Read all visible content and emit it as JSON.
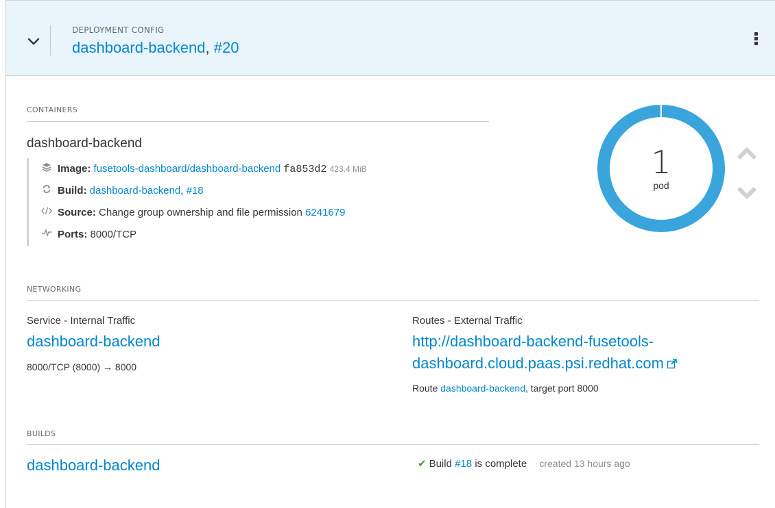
{
  "header": {
    "kind": "DEPLOYMENT CONFIG",
    "name": "dashboard-backend",
    "separator": ",",
    "revision": "#20"
  },
  "containers": {
    "section_label": "CONTAINERS",
    "container_name": "dashboard-backend",
    "image": {
      "label": "Image:",
      "link": "fusetools-dashboard/dashboard-backend",
      "id": "fa853d2",
      "size": "423.4 MiB"
    },
    "build": {
      "label": "Build:",
      "name": "dashboard-backend",
      "separator": ",",
      "number": "#18"
    },
    "source": {
      "label": "Source:",
      "message": "Change group ownership and file permission",
      "commit": "6241679"
    },
    "ports": {
      "label": "Ports:",
      "value": "8000/TCP"
    }
  },
  "pods": {
    "count": "1",
    "unit": "pod",
    "ring_color": "#39a5dc",
    "ready_fraction": 1.0
  },
  "networking": {
    "section_label": "NETWORKING",
    "service": {
      "title": "Service - Internal Traffic",
      "name": "dashboard-backend",
      "mapping": "8000/TCP (8000) → 8000"
    },
    "routes": {
      "title": "Routes - External Traffic",
      "url_line1": "http://dashboard-backend-fusetools-",
      "url_line2": "dashboard.cloud.paas.psi.redhat.com",
      "route_prefix": "Route",
      "route_name": "dashboard-backend",
      "route_suffix": ", target port 8000"
    }
  },
  "builds": {
    "section_label": "BUILDS",
    "name": "dashboard-backend",
    "status_prefix": "Build",
    "number": "#18",
    "status_suffix": "is complete",
    "created": "created 13 hours ago"
  },
  "colors": {
    "link": "#0088ce",
    "header_bg": "#eaf4fb",
    "success": "#3f9c35"
  }
}
